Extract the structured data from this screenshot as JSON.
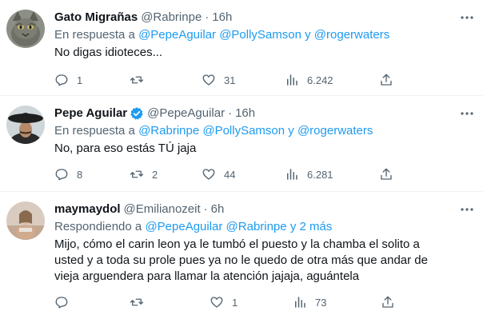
{
  "tweets": [
    {
      "name": "Gato Migrañas",
      "handle": "@Rabrinpe",
      "time": "16h",
      "verified": false,
      "reply_prefix": "En respuesta a",
      "reply_links": "@PepeAguilar @PollySamson y @rogerwaters",
      "text": "No digas idioteces...",
      "replies": "1",
      "retweets": "",
      "likes": "31",
      "views": "6.242"
    },
    {
      "name": "Pepe Aguilar",
      "handle": "@PepeAguilar",
      "time": "16h",
      "verified": true,
      "reply_prefix": "En respuesta a",
      "reply_links": "@Rabrinpe @PollySamson y @rogerwaters",
      "text": "No, para eso estás TÚ jaja",
      "replies": "8",
      "retweets": "2",
      "likes": "44",
      "views": "6.281"
    },
    {
      "name": "maymaydol",
      "handle": "@Emilianozeit",
      "time": "6h",
      "verified": false,
      "reply_prefix": "Respondiendo a",
      "reply_links": "@PepeAguilar @Rabrinpe y 2 más",
      "text": "Mijo, cómo el carin leon ya le tumbó el puesto y la chamba el solito a usted y a toda su prole pues ya no le quedo de otra más que andar de vieja arguendera para llamar la atención jajaja, aguántela",
      "replies": "",
      "retweets": "",
      "likes": "1",
      "views": "73"
    }
  ],
  "colors": {
    "link": "#1d9bf0",
    "secondary_text": "#536471",
    "primary_text": "#0f1419",
    "divider": "#eff3f4"
  },
  "icons": [
    "reply-icon",
    "retweet-icon",
    "like-icon",
    "views-icon",
    "share-icon",
    "more-icon",
    "verified-badge-icon"
  ]
}
